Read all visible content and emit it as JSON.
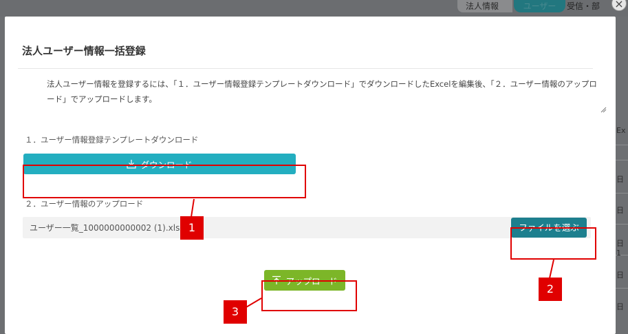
{
  "background": {
    "tabs": [
      "法人情報",
      "ユーザー",
      "受信・部"
    ],
    "right_labels": [
      "Ex",
      "日",
      "日",
      "日 1",
      "日",
      "日"
    ]
  },
  "modal": {
    "title": "法人ユーザー情報一括登録",
    "description": "法人ユーザー情報を登録するには、「１．ユーザー情報登録テンプレートダウンロード」でダウンロードしたExcelを編集後、「２．ユーザー情報のアップロード」でアップロードします。",
    "step1_label": "１．ユーザー情報登録テンプレートダウンロード",
    "download_label": "ダウンロード",
    "step2_label": "２．ユーザー情報のアップロード",
    "file_name": "ユーザー一覧_1000000000002 (1).xlsx",
    "choose_file_label": "ファイルを選ぶ",
    "upload_label": "アップロード"
  },
  "annotations": {
    "badge1": "1",
    "badge2": "2",
    "badge3": "3",
    "color": "#e00000"
  },
  "colors": {
    "download": "#23aec0",
    "choose": "#1d7f8e",
    "upload": "#7cb628"
  }
}
